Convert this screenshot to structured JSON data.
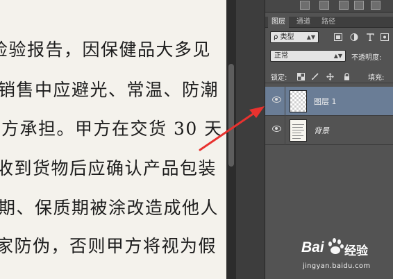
{
  "document": {
    "lines": [
      "检验报告，因保健品大多见",
      "销售中应避光、常温、防潮",
      "方承担。甲方在交货 30 天",
      "收到货物后应确认产品包装",
      "期、保质期被涂改造成他人",
      "家防伪，否则甲方将视为假"
    ]
  },
  "panel": {
    "tabs": [
      "图层",
      "通道",
      "路径"
    ],
    "filter": {
      "kind_label": "ρ 类型",
      "icons": [
        "image-filter-icon",
        "adjustment-filter-icon",
        "type-filter-icon",
        "shape-filter-icon"
      ]
    },
    "blend": {
      "mode": "正常",
      "opacity_label": "不透明度:"
    },
    "lock": {
      "label": "锁定:",
      "icons": [
        "lock-transparency-icon",
        "lock-paint-icon",
        "lock-move-icon",
        "lock-all-icon"
      ],
      "fill_label": "填充:"
    },
    "layers": [
      {
        "name": "图层 1",
        "selected": true,
        "thumbnail": "transparent"
      },
      {
        "name": "背景",
        "selected": false,
        "thumbnail": "document"
      }
    ]
  },
  "annotation": {
    "arrow_color": "#e8322f"
  },
  "watermark": {
    "brand_left": "Bai",
    "brand_right": "经验",
    "url": "jingyan.baidu.com"
  },
  "colors": {
    "panel_bg": "#535353",
    "selected_layer": "#6a7d96",
    "canvas_bg": "#f4f2ec"
  }
}
